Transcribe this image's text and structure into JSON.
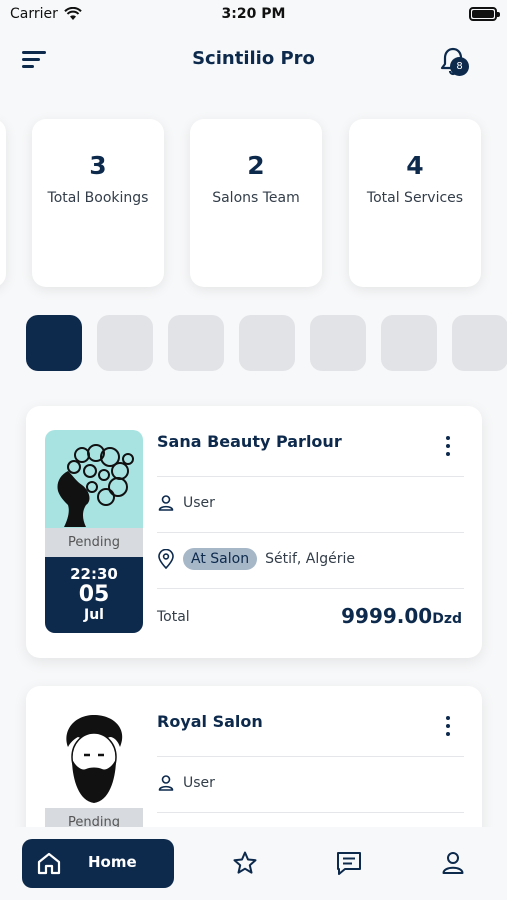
{
  "status_bar": {
    "carrier": "Carrier",
    "time": "3:20 PM"
  },
  "header": {
    "title": "Scintilio Pro",
    "notification_count": "8"
  },
  "stats": [
    {
      "value": "3",
      "label": "Total Bookings"
    },
    {
      "value": "2",
      "label": "Salons Team"
    },
    {
      "value": "4",
      "label": "Total Services"
    }
  ],
  "bookings": [
    {
      "salon": "Sana Beauty Parlour",
      "status": "Pending",
      "hour": "22:30",
      "day": "05",
      "month": "Jul",
      "user": "User",
      "service_type": "At Salon",
      "location": "Sétif, Algérie",
      "total_label": "Total",
      "total_value": "9999.00",
      "currency": "Dzd",
      "thumb_color": "#a8e3e2"
    },
    {
      "salon": "Royal Salon",
      "status": "Pending",
      "user": "User"
    }
  ],
  "tab_bar": {
    "home_label": "Home"
  },
  "colors": {
    "primary": "#0d2a4d",
    "chip": "#e1e3e6",
    "pill": "#a6b7c8"
  }
}
